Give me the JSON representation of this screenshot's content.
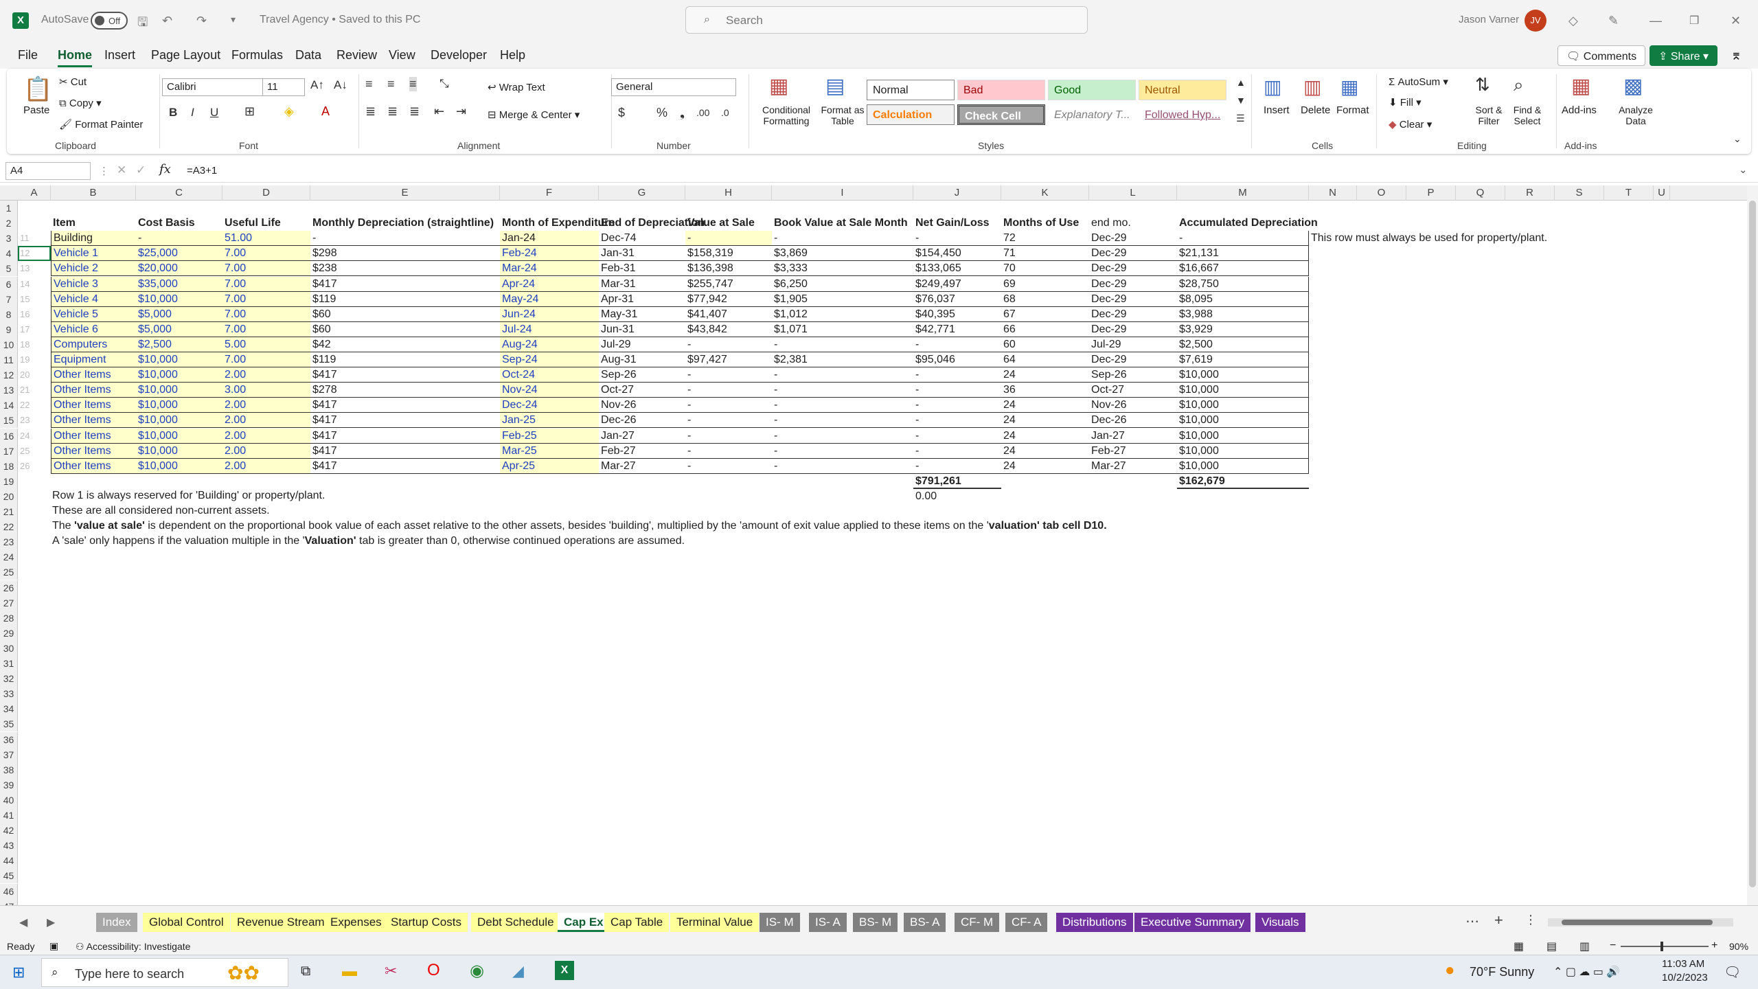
{
  "titlebar": {
    "autosave_label": "AutoSave",
    "autosave_state": "Off",
    "doc_title": "Travel Agency • Saved to this PC",
    "search_placeholder": "Search",
    "user_name": "Jason Varner",
    "user_initials": "JV"
  },
  "menu": {
    "items": [
      "File",
      "Home",
      "Insert",
      "Page Layout",
      "Formulas",
      "Data",
      "Review",
      "View",
      "Developer",
      "Help"
    ],
    "active": "Home",
    "comments": "Comments",
    "share": "Share"
  },
  "ribbon": {
    "clipboard": {
      "paste": "Paste",
      "cut": "Cut",
      "copy": "Copy",
      "format_painter": "Format Painter",
      "group": "Clipboard"
    },
    "font": {
      "name": "Calibri",
      "size": "11",
      "group": "Font"
    },
    "alignment": {
      "wrap": "Wrap Text",
      "merge": "Merge & Center",
      "group": "Alignment"
    },
    "number": {
      "format": "General",
      "group": "Number"
    },
    "styles": {
      "conditional": "Conditional Formatting",
      "format_table": "Format as Table",
      "normal": "Normal",
      "bad": "Bad",
      "good": "Good",
      "neutral": "Neutral",
      "calculation": "Calculation",
      "check_cell": "Check Cell",
      "explanatory": "Explanatory T...",
      "followed": "Followed Hyp...",
      "group": "Styles"
    },
    "cells": {
      "insert": "Insert",
      "delete": "Delete",
      "format": "Format",
      "group": "Cells"
    },
    "editing": {
      "autosum": "AutoSum",
      "fill": "Fill",
      "clear": "Clear",
      "sort": "Sort & Filter",
      "find": "Find & Select",
      "group": "Editing"
    },
    "addins": {
      "addins": "Add-ins",
      "analyze": "Analyze Data",
      "group": "Add-ins"
    }
  },
  "formula_bar": {
    "name_box": "A4",
    "formula": "=A3+1"
  },
  "columns": [
    "A",
    "B",
    "C",
    "D",
    "E",
    "F",
    "G",
    "H",
    "I",
    "J",
    "K",
    "L",
    "M",
    "N",
    "O",
    "P",
    "Q",
    "R",
    "S",
    "T",
    "U"
  ],
  "headers": [
    "Item",
    "Cost Basis",
    "Useful Life",
    "Monthly Depreciation (straightline)",
    "Month of Expenditure",
    "End of Depreciation",
    "Value at Sale",
    "Book Value at Sale Month",
    "Net Gain/Loss",
    "Months of Use",
    "end mo.",
    "Accumulated Depreciation"
  ],
  "rows": [
    {
      "a": "11",
      "item": "Building",
      "cost": "-",
      "life": "51.00",
      "dep": "-",
      "month": "Jan-24",
      "end": "Dec-74",
      "sale": "-",
      "book": "-",
      "gain": "-",
      "use": "72",
      "endmo": "Dec-29",
      "acc": "-"
    },
    {
      "a": "12",
      "item": "Vehicle 1",
      "cost": "$25,000",
      "life": "7.00",
      "dep": "$298",
      "month": "Feb-24",
      "end": "Jan-31",
      "sale": "$158,319",
      "book": "$3,869",
      "gain": "$154,450",
      "use": "71",
      "endmo": "Dec-29",
      "acc": "$21,131"
    },
    {
      "a": "13",
      "item": "Vehicle 2",
      "cost": "$20,000",
      "life": "7.00",
      "dep": "$238",
      "month": "Mar-24",
      "end": "Feb-31",
      "sale": "$136,398",
      "book": "$3,333",
      "gain": "$133,065",
      "use": "70",
      "endmo": "Dec-29",
      "acc": "$16,667"
    },
    {
      "a": "14",
      "item": "Vehicle 3",
      "cost": "$35,000",
      "life": "7.00",
      "dep": "$417",
      "month": "Apr-24",
      "end": "Mar-31",
      "sale": "$255,747",
      "book": "$6,250",
      "gain": "$249,497",
      "use": "69",
      "endmo": "Dec-29",
      "acc": "$28,750"
    },
    {
      "a": "15",
      "item": "Vehicle 4",
      "cost": "$10,000",
      "life": "7.00",
      "dep": "$119",
      "month": "May-24",
      "end": "Apr-31",
      "sale": "$77,942",
      "book": "$1,905",
      "gain": "$76,037",
      "use": "68",
      "endmo": "Dec-29",
      "acc": "$8,095"
    },
    {
      "a": "16",
      "item": "Vehicle 5",
      "cost": "$5,000",
      "life": "7.00",
      "dep": "$60",
      "month": "Jun-24",
      "end": "May-31",
      "sale": "$41,407",
      "book": "$1,012",
      "gain": "$40,395",
      "use": "67",
      "endmo": "Dec-29",
      "acc": "$3,988"
    },
    {
      "a": "17",
      "item": "Vehicle 6",
      "cost": "$5,000",
      "life": "7.00",
      "dep": "$60",
      "month": "Jul-24",
      "end": "Jun-31",
      "sale": "$43,842",
      "book": "$1,071",
      "gain": "$42,771",
      "use": "66",
      "endmo": "Dec-29",
      "acc": "$3,929"
    },
    {
      "a": "18",
      "item": "Computers",
      "cost": "$2,500",
      "life": "5.00",
      "dep": "$42",
      "month": "Aug-24",
      "end": "Jul-29",
      "sale": "-",
      "book": "-",
      "gain": "-",
      "use": "60",
      "endmo": "Jul-29",
      "acc": "$2,500"
    },
    {
      "a": "19",
      "item": "Equipment",
      "cost": "$10,000",
      "life": "7.00",
      "dep": "$119",
      "month": "Sep-24",
      "end": "Aug-31",
      "sale": "$97,427",
      "book": "$2,381",
      "gain": "$95,046",
      "use": "64",
      "endmo": "Dec-29",
      "acc": "$7,619"
    },
    {
      "a": "20",
      "item": "Other Items",
      "cost": "$10,000",
      "life": "2.00",
      "dep": "$417",
      "month": "Oct-24",
      "end": "Sep-26",
      "sale": "-",
      "book": "-",
      "gain": "-",
      "use": "24",
      "endmo": "Sep-26",
      "acc": "$10,000"
    },
    {
      "a": "21",
      "item": "Other Items",
      "cost": "$10,000",
      "life": "3.00",
      "dep": "$278",
      "month": "Nov-24",
      "end": "Oct-27",
      "sale": "-",
      "book": "-",
      "gain": "-",
      "use": "36",
      "endmo": "Oct-27",
      "acc": "$10,000"
    },
    {
      "a": "22",
      "item": "Other Items",
      "cost": "$10,000",
      "life": "2.00",
      "dep": "$417",
      "month": "Dec-24",
      "end": "Nov-26",
      "sale": "-",
      "book": "-",
      "gain": "-",
      "use": "24",
      "endmo": "Nov-26",
      "acc": "$10,000"
    },
    {
      "a": "23",
      "item": "Other Items",
      "cost": "$10,000",
      "life": "2.00",
      "dep": "$417",
      "month": "Jan-25",
      "end": "Dec-26",
      "sale": "-",
      "book": "-",
      "gain": "-",
      "use": "24",
      "endmo": "Dec-26",
      "acc": "$10,000"
    },
    {
      "a": "24",
      "item": "Other Items",
      "cost": "$10,000",
      "life": "2.00",
      "dep": "$417",
      "month": "Feb-25",
      "end": "Jan-27",
      "sale": "-",
      "book": "-",
      "gain": "-",
      "use": "24",
      "endmo": "Jan-27",
      "acc": "$10,000"
    },
    {
      "a": "25",
      "item": "Other Items",
      "cost": "$10,000",
      "life": "2.00",
      "dep": "$417",
      "month": "Mar-25",
      "end": "Feb-27",
      "sale": "-",
      "book": "-",
      "gain": "-",
      "use": "24",
      "endmo": "Feb-27",
      "acc": "$10,000"
    },
    {
      "a": "26",
      "item": "Other Items",
      "cost": "$10,000",
      "life": "2.00",
      "dep": "$417",
      "month": "Apr-25",
      "end": "Mar-27",
      "sale": "-",
      "book": "-",
      "gain": "-",
      "use": "24",
      "endmo": "Mar-27",
      "acc": "$10,000"
    }
  ],
  "side_note": "This row must always be used for property/plant.",
  "totals": {
    "gain": "$791,261",
    "gain_sub": "0.00",
    "acc": "$162,679"
  },
  "notes": {
    "n20": "Row 1 is always reserved for 'Building' or property/plant.",
    "n21": "These are all considered non-current assets.",
    "n22_a": "The ",
    "n22_b": "'value at sale'",
    "n22_c": " is dependent on the proportional book value of each asset relative to the other assets, besides 'building', multiplied by the 'amount of exit value applied to these items on the '",
    "n22_d": "valuation' tab cell D10.",
    "n23_a": "A 'sale' only happens if the valuation multiple in the '",
    "n23_b": "Valuation'",
    "n23_c": " tab is greater than 0, otherwise continued operations are assumed."
  },
  "row_numbers": [
    "1",
    "2",
    "3",
    "4",
    "5",
    "6",
    "7",
    "8",
    "9",
    "10",
    "11",
    "12",
    "13",
    "14",
    "15",
    "16",
    "17",
    "18",
    "19",
    "20",
    "21",
    "22",
    "23",
    "24",
    "25",
    "26",
    "27",
    "28",
    "29",
    "30",
    "31",
    "32",
    "33",
    "34",
    "35",
    "36",
    "37",
    "38",
    "39",
    "40",
    "41",
    "42",
    "43",
    "44",
    "45",
    "46",
    "47"
  ],
  "tabs": [
    {
      "label": "Index",
      "color": "#a6a6a6"
    },
    {
      "label": "Global Control",
      "color": "#ffff99"
    },
    {
      "label": "Revenue Streams",
      "color": "#ffff99"
    },
    {
      "label": "Expenses",
      "color": "#ffff99"
    },
    {
      "label": "Startup Costs",
      "color": "#ffff99"
    },
    {
      "label": "Debt Schedule",
      "color": "#ffff99"
    },
    {
      "label": "Cap Ex",
      "color": "#ffffff"
    },
    {
      "label": "Cap Table",
      "color": "#ffff99"
    },
    {
      "label": "Terminal Value",
      "color": "#ffff99"
    },
    {
      "label": "IS- M",
      "color": "#808080"
    },
    {
      "label": "IS- A",
      "color": "#808080"
    },
    {
      "label": "BS- M",
      "color": "#808080"
    },
    {
      "label": "BS- A",
      "color": "#808080"
    },
    {
      "label": "CF- M",
      "color": "#808080"
    },
    {
      "label": "CF- A",
      "color": "#808080"
    },
    {
      "label": "Distributions",
      "color": "#7030a0"
    },
    {
      "label": "Executive Summary",
      "color": "#7030a0"
    },
    {
      "label": "Visuals",
      "color": "#7030a0"
    }
  ],
  "status": {
    "ready": "Ready",
    "accessibility": "Accessibility: Investigate",
    "zoom": "90%"
  },
  "taskbar": {
    "search": "Type here to search",
    "weather": "70°F  Sunny",
    "time": "11:03 AM",
    "date": "10/2/2023"
  }
}
